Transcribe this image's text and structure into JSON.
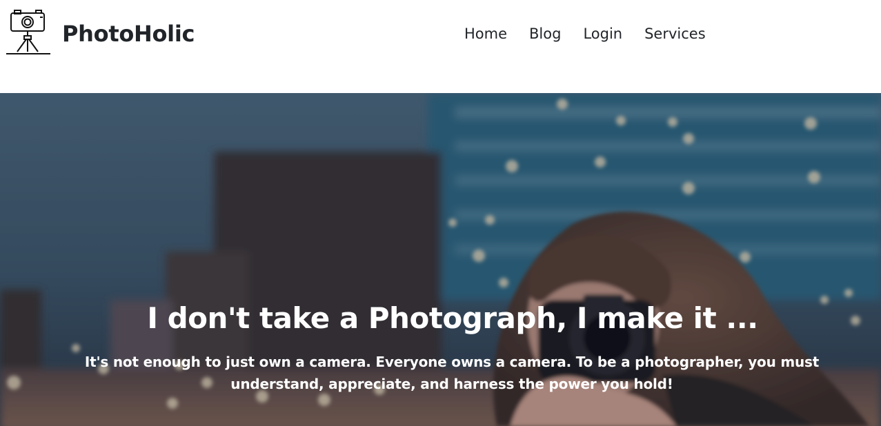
{
  "brand": {
    "name": "PhotoHolic",
    "logo_icon": "camera-tripod-icon"
  },
  "nav": {
    "items": [
      {
        "label": "Home"
      },
      {
        "label": "Blog"
      },
      {
        "label": "Login"
      },
      {
        "label": "Services"
      }
    ]
  },
  "hero": {
    "title": "I don't take a Photograph, I make it ...",
    "subtitle": "It's not enough to just own a camera. Everyone owns a camera. To be a photographer, you must understand, appreciate, and harness the power you hold!",
    "background_image": "woman-with-camera-city-photo"
  },
  "colors": {
    "text_dark": "#212529",
    "hero_text": "#ffffff"
  }
}
